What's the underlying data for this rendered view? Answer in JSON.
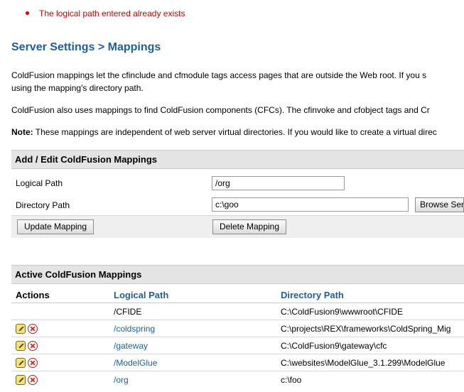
{
  "error": {
    "message": "The logical path entered already exists"
  },
  "page": {
    "title": "Server Settings > Mappings"
  },
  "intro": {
    "line1": "ColdFusion mappings let the cfinclude and cfmodule tags access pages that are outside the Web root. If you s",
    "line2": "using the mapping's directory path.",
    "line3": "ColdFusion also uses mappings to find ColdFusion components (CFCs). The cfinvoke and cfobject tags and Cr",
    "note_label": "Note:",
    "note_text": " These mappings are independent of web server virtual directories. If you would like to create a virtual direc"
  },
  "edit_section": {
    "title": "Add / Edit ColdFusion Mappings",
    "logical_path_label": "Logical Path",
    "logical_path_value": "/org",
    "directory_path_label": "Directory Path",
    "directory_path_value": "c:\\goo",
    "browse_label": "Browse Server",
    "update_label": "Update Mapping",
    "delete_label": "Delete Mapping"
  },
  "active_section": {
    "title": "Active ColdFusion Mappings",
    "columns": [
      "Actions",
      "Logical Path",
      "Directory Path"
    ],
    "rows": [
      {
        "logical_path": "/CFIDE",
        "directory_path": "C:\\ColdFusion9\\wwwroot\\CFIDE",
        "has_actions": false
      },
      {
        "logical_path": "/coldspring",
        "directory_path": "C:\\projects\\REX\\frameworks\\ColdSpring_Mig",
        "has_actions": true
      },
      {
        "logical_path": "/gateway",
        "directory_path": "C:\\ColdFusion9\\gateway\\cfc",
        "has_actions": true
      },
      {
        "logical_path": "/ModelGlue",
        "directory_path": "C:\\websites\\ModelGlue_3.1.299\\ModelGlue",
        "has_actions": true
      },
      {
        "logical_path": "/org",
        "directory_path": "c:\\foo",
        "has_actions": true
      }
    ]
  },
  "icons": {
    "edit": "edit-icon",
    "delete": "delete-icon"
  },
  "colors": {
    "link": "#1f5e9a",
    "error": "#cc0000",
    "section_bg": "#e4e4e4"
  }
}
